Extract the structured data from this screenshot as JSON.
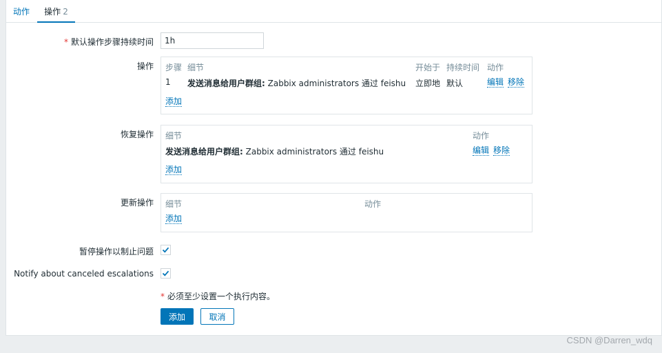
{
  "tabs": {
    "actions": "动作",
    "operations": "操作",
    "operations_count": "2"
  },
  "default_duration": {
    "label": "默认操作步骤持续时间",
    "value": "1h"
  },
  "operations": {
    "label": "操作",
    "headers": {
      "steps": "步骤",
      "details": "细节",
      "start_in": "开始于",
      "duration": "持续时间",
      "action": "动作"
    },
    "rows": [
      {
        "step": "1",
        "details_bold": "发送消息给用户群组:",
        "details_rest": " Zabbix administrators 通过 feishu",
        "start_in": "立即地",
        "duration": "默认",
        "edit": "编辑",
        "remove": "移除"
      }
    ],
    "add": "添加"
  },
  "recovery": {
    "label": "恢复操作",
    "headers": {
      "details": "细节",
      "action": "动作"
    },
    "rows": [
      {
        "details_bold": "发送消息给用户群组:",
        "details_rest": " Zabbix administrators 通过 feishu",
        "edit": "编辑",
        "remove": "移除"
      }
    ],
    "add": "添加"
  },
  "update": {
    "label": "更新操作",
    "headers": {
      "details": "细节",
      "action": "动作"
    },
    "add": "添加"
  },
  "pause_problems": {
    "label": "暂停操作以制止问题",
    "checked": true
  },
  "notify_canceled": {
    "label": "Notify about canceled escalations",
    "checked": true
  },
  "note": "必须至少设置一个执行内容。",
  "buttons": {
    "add": "添加",
    "cancel": "取消"
  },
  "watermark": "CSDN @Darren_wdq",
  "colors": {
    "accent": "#0275b8",
    "required": "#e33734",
    "muted": "#768d99"
  }
}
